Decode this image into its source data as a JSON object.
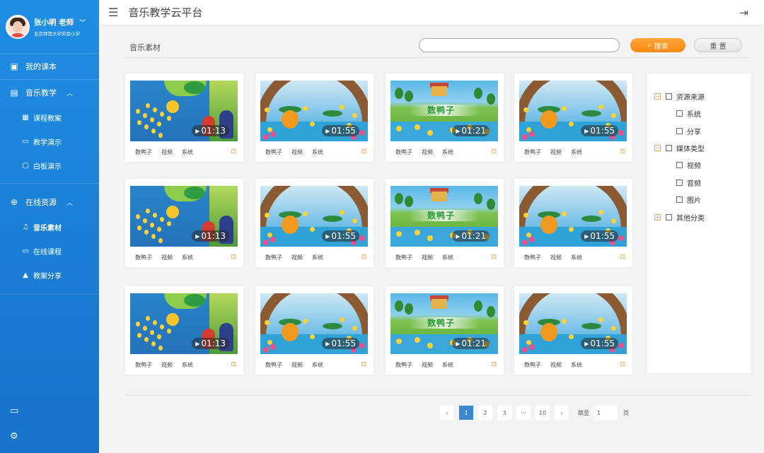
{
  "profile": {
    "name": "张小明 老师",
    "school": "北京师范大学实验小学"
  },
  "sidebar": {
    "my_lessons": "我的课本",
    "music_teaching": {
      "label": "音乐教学",
      "items": [
        "课程教案",
        "教学演示",
        "白板演示"
      ]
    },
    "online_resources": {
      "label": "在线资源",
      "items": [
        "音乐素材",
        "在线课程",
        "教案分享"
      ]
    }
  },
  "header": {
    "title": "音乐教学云平台"
  },
  "main": {
    "section_title": "音乐素材",
    "search": {
      "placeholder": "",
      "button": "搜索",
      "reset": "重 置"
    }
  },
  "cards": [
    {
      "title": "数鸭子",
      "type": "视频",
      "source": "系统",
      "duration": "01:13"
    },
    {
      "title": "数鸭子",
      "type": "视频",
      "source": "系统",
      "duration": "01:55"
    },
    {
      "title": "数鸭子",
      "type": "视频",
      "source": "系统",
      "duration": "01:21"
    },
    {
      "title": "数鸭子",
      "type": "视频",
      "source": "系统",
      "duration": "01:55"
    },
    {
      "title": "数鸭子",
      "type": "视频",
      "source": "系统",
      "duration": "01:13"
    },
    {
      "title": "数鸭子",
      "type": "视频",
      "source": "系统",
      "duration": "01:55"
    },
    {
      "title": "数鸭子",
      "type": "视频",
      "source": "系统",
      "duration": "01:21"
    },
    {
      "title": "数鸭子",
      "type": "视频",
      "source": "系统",
      "duration": "01:55"
    },
    {
      "title": "数鸭子",
      "type": "视频",
      "source": "系统",
      "duration": "01:13"
    },
    {
      "title": "数鸭子",
      "type": "视频",
      "source": "系统",
      "duration": "01:55"
    },
    {
      "title": "数鸭子",
      "type": "视频",
      "source": "系统",
      "duration": "01:21"
    },
    {
      "title": "数鸭子",
      "type": "视频",
      "source": "系统",
      "duration": "01:55"
    }
  ],
  "thumb_banner_text": "数鸭子",
  "filter": {
    "resource_source": {
      "label": "资源来源",
      "options": [
        "系统",
        "分享"
      ]
    },
    "media_type": {
      "label": "媒体类型",
      "options": [
        "视频",
        "音频",
        "图片"
      ]
    },
    "other": {
      "label": "其他分类"
    }
  },
  "pagination": {
    "prev": "‹",
    "next": "›",
    "pages": [
      "1",
      "2",
      "3",
      "···",
      "10"
    ],
    "current": "1",
    "goto_label": "跳至",
    "goto_value": "1",
    "page_suffix": "页"
  },
  "icons": {
    "menu_toggle": "menu-collapse-icon",
    "logout": "logout-icon",
    "search": "search-icon",
    "favorite": "bookmark-icon"
  },
  "colors": {
    "sidebar": "#1a80d8",
    "accent": "#f58a10",
    "active_page": "#3a86d1"
  }
}
